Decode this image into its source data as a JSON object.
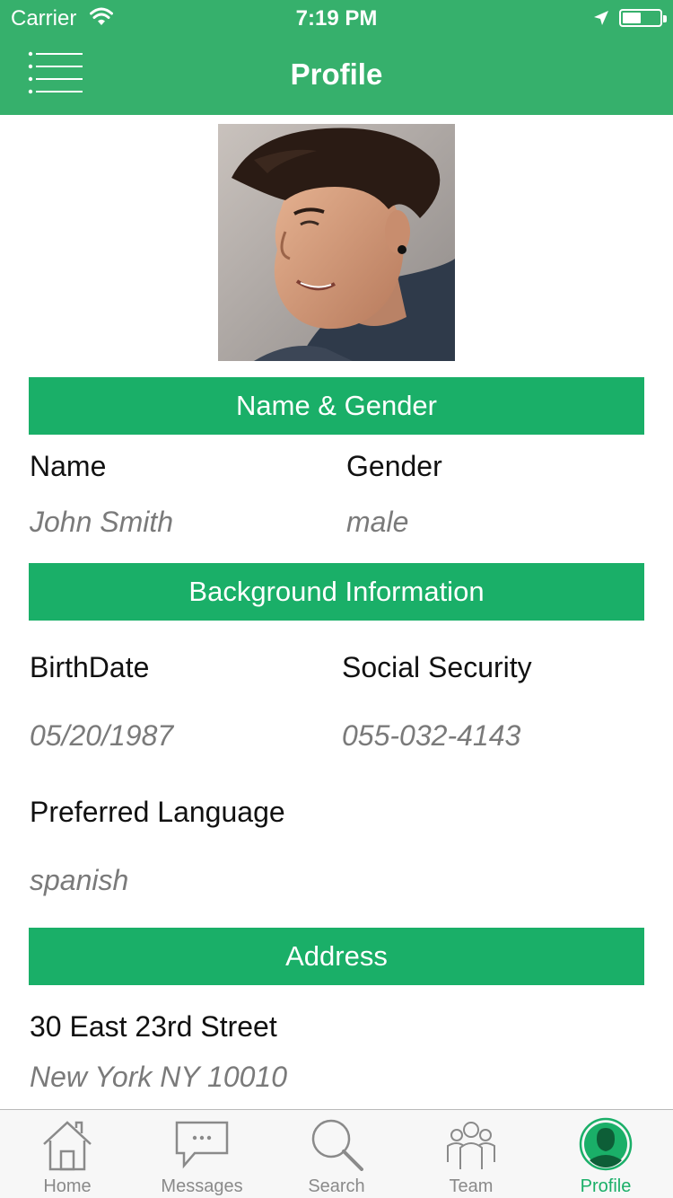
{
  "status_bar": {
    "carrier": "Carrier",
    "time": "7:19 PM"
  },
  "nav": {
    "title": "Profile",
    "menu_icon": "menu-list-icon"
  },
  "colors": {
    "brand_green": "#36b06c",
    "section_green": "#1aaf68",
    "value_gray": "#7a7a7a"
  },
  "sections": {
    "name_gender": "Name & Gender",
    "background": "Background Information",
    "address": "Address"
  },
  "profile": {
    "name_label": "Name",
    "name_value": "John Smith",
    "gender_label": "Gender",
    "gender_value": "male",
    "birthdate_label": "BirthDate",
    "birthdate_value": "05/20/1987",
    "ssn_label": "Social Security",
    "ssn_value": "055-032-4143",
    "language_label": "Preferred Language",
    "language_value": "spanish",
    "address_line1": "30 East 23rd Street",
    "address_line2": "New York NY 10010"
  },
  "tabs": [
    {
      "label": "Home",
      "icon": "home-icon",
      "active": false
    },
    {
      "label": "Messages",
      "icon": "messages-icon",
      "active": false
    },
    {
      "label": "Search",
      "icon": "search-icon",
      "active": false
    },
    {
      "label": "Team",
      "icon": "team-icon",
      "active": false
    },
    {
      "label": "Profile",
      "icon": "profile-icon",
      "active": true
    }
  ]
}
